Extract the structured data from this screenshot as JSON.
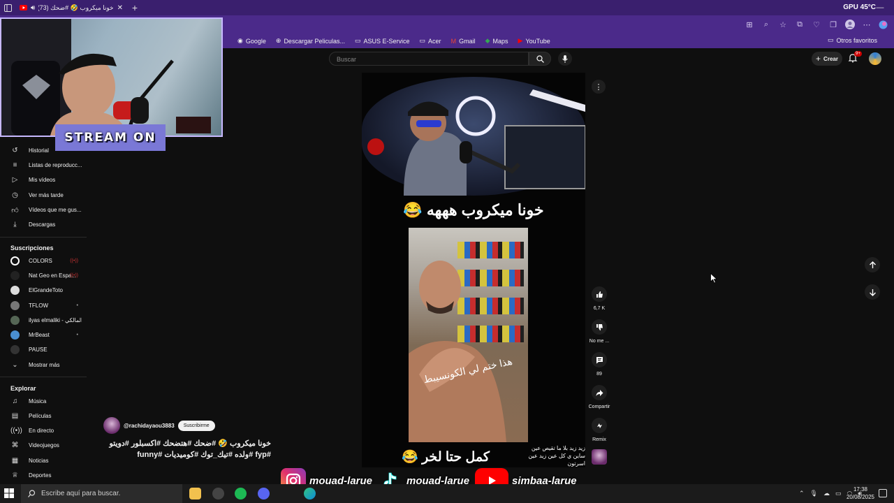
{
  "browser": {
    "tab_title": "خونا ميكروب 🤣 #ضحك (73)",
    "new_tab_icon": "plus-icon",
    "gpu_label": "GPU",
    "gpu_temp": "45°C",
    "accent": "#4b2a8a"
  },
  "bookmarks": {
    "items": [
      {
        "icon": "google-icon",
        "label": "Google"
      },
      {
        "icon": "globe-icon",
        "label": "Descargar Peliculas..."
      },
      {
        "icon": "folder-icon",
        "label": "ASUS E-Service"
      },
      {
        "icon": "folder-icon",
        "label": "Acer"
      },
      {
        "icon": "gmail-icon",
        "label": "Gmail"
      },
      {
        "icon": "maps-icon",
        "label": "Maps"
      },
      {
        "icon": "youtube-icon",
        "label": "YouTube"
      }
    ],
    "other": "Otros favoritos"
  },
  "youtube": {
    "search_placeholder": "Buscar",
    "create_label": "Crear",
    "notif_count": "9+"
  },
  "sidebar": {
    "you_items": [
      {
        "icon": "history-icon",
        "label": "Historial"
      },
      {
        "icon": "playlist-icon",
        "label": "Listas de reproducc..."
      },
      {
        "icon": "my-videos-icon",
        "label": "Mis vídeos"
      },
      {
        "icon": "watch-later-icon",
        "label": "Ver más tarde"
      },
      {
        "icon": "liked-icon",
        "label": "Vídeos que me gus..."
      },
      {
        "icon": "download-icon",
        "label": "Descargas"
      }
    ],
    "subs_heading": "Suscripciones",
    "subs": [
      {
        "label": "COLORS",
        "color": "#ffffff",
        "live": true
      },
      {
        "label": "Nat Geo en Espa...",
        "color": "#222222",
        "live": true
      },
      {
        "label": "ElGrandeToto",
        "color": "#dddddd",
        "live": false
      },
      {
        "label": "TFLOW",
        "color": "#777777",
        "live": true
      },
      {
        "label": "ilyas elmaliki - المالكي ...",
        "color": "#556655",
        "live": false
      },
      {
        "label": "MrBeast",
        "color": "#4a8fd0",
        "live": true
      },
      {
        "label": "PAUSE",
        "color": "#333333",
        "live": false
      }
    ],
    "show_more": "Mostrar más",
    "explore_heading": "Explorar",
    "explore": [
      {
        "icon": "music-icon",
        "label": "Música"
      },
      {
        "icon": "movies-icon",
        "label": "Películas"
      },
      {
        "icon": "live-icon",
        "label": "En directo"
      },
      {
        "icon": "gaming-icon",
        "label": "Videojuegos"
      },
      {
        "icon": "news-icon",
        "label": "Noticias"
      },
      {
        "icon": "sports-icon",
        "label": "Deportes"
      }
    ]
  },
  "short": {
    "caption_top": "خونا ميكروب هههه 😂",
    "photo_text": "هذا ختم لي الكونسيبط",
    "caption_bottom": "كمل حتا لخر 😂",
    "caption_side": "زيد زيد بلا ما تقيص عين ساين ي كل عين زيد عين اسرتون"
  },
  "actions": {
    "likes": "6,7 K",
    "dislike": "No me ...",
    "comments": "89",
    "share": "Compartir",
    "remix": "Remix"
  },
  "channel": {
    "handle": "@rachidayaou3883",
    "subscribe": "Suscribirme",
    "title": "خونا ميكروب 🤣 #ضحك #هتضحك #اكسبلور #دويتو #fyp #ولده #تيك_توك #كوميديات #funny"
  },
  "overlay": {
    "stream_badge": "STREAM ON",
    "instagram": "mouad-larue",
    "tiktok": "mouad-larue",
    "youtube": "simbaa-larue"
  },
  "taskbar": {
    "search_placeholder": "Escribe aquí para buscar.",
    "time": "17:38",
    "date": "20/08/2025"
  }
}
